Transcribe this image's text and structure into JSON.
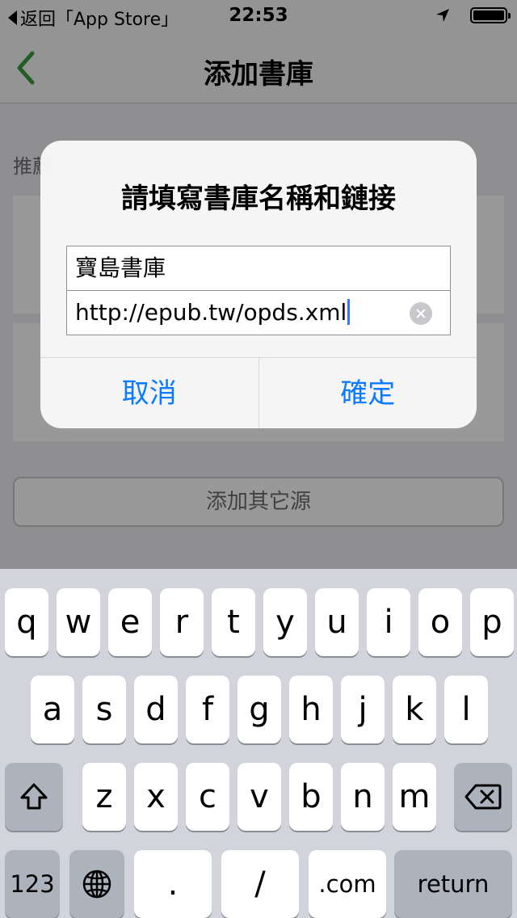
{
  "status_bar": {
    "back_label": "返回「App Store」",
    "time": "22:53"
  },
  "nav": {
    "title": "添加書庫"
  },
  "content": {
    "section_header": "推薦",
    "add_source_label": "添加其它源"
  },
  "dialog": {
    "title": "請填寫書庫名稱和鏈接",
    "name_value": "寶島書庫",
    "url_value": "http://epub.tw/opds.xml",
    "cancel_label": "取消",
    "confirm_label": "確定"
  },
  "keyboard": {
    "row1": [
      "q",
      "w",
      "e",
      "r",
      "t",
      "y",
      "u",
      "i",
      "o",
      "p"
    ],
    "row2": [
      "a",
      "s",
      "d",
      "f",
      "g",
      "h",
      "j",
      "k",
      "l"
    ],
    "row3": [
      "z",
      "x",
      "c",
      "v",
      "b",
      "n",
      "m"
    ],
    "numbers_label": "123",
    "period_label": ".",
    "slash_label": "/",
    "dotcom_label": ".com",
    "return_label": "return"
  },
  "colors": {
    "accent_green": "#3a9b3d",
    "system_blue": "#0a7aff"
  }
}
